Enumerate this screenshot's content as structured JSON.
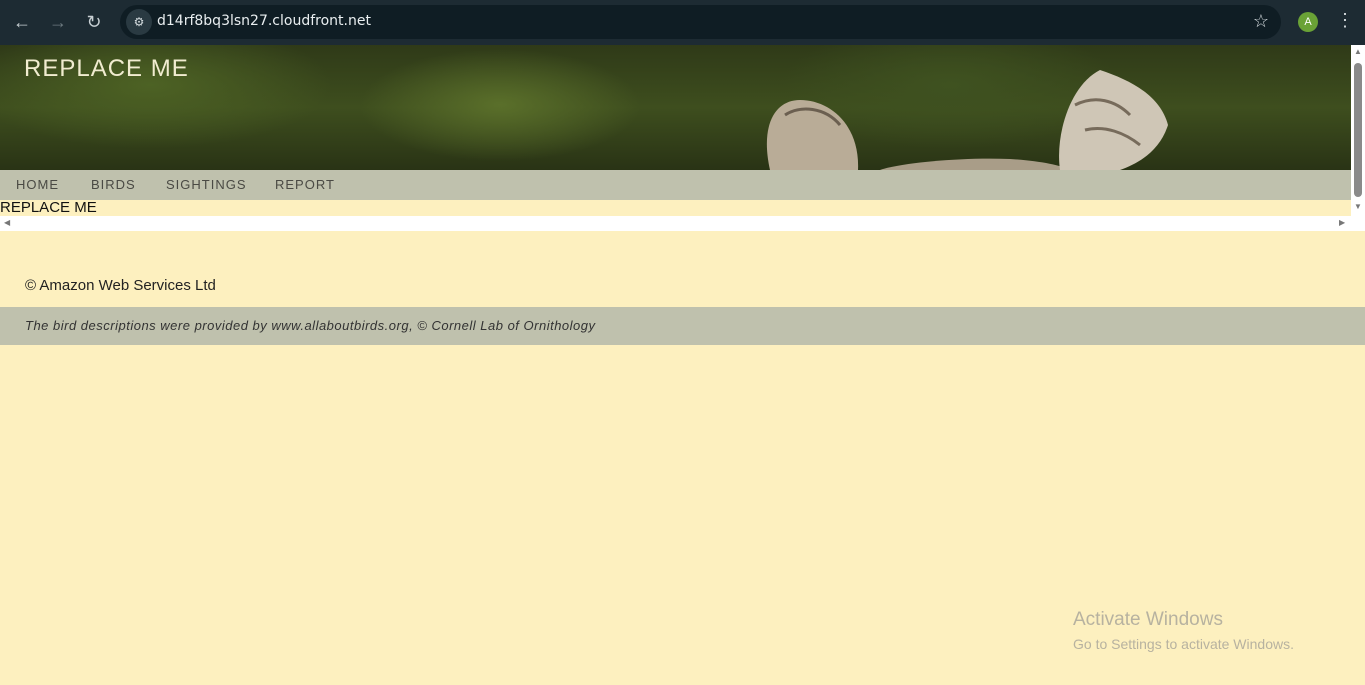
{
  "browser": {
    "url": "d14rf8bq3lsn27.cloudfront.net",
    "back_icon": "arrow-left",
    "forward_icon": "arrow-right",
    "reload_icon": "reload",
    "site_info_icon": "tune",
    "bookmark_icon": "star",
    "profile_initial": "A",
    "menu_icon": "more-vert"
  },
  "header": {
    "title": "REPLACE ME"
  },
  "nav": {
    "items": [
      "HOME",
      "BIRDS",
      "SIGHTINGS",
      "REPORT"
    ]
  },
  "content": {
    "placeholder": "REPLACE ME"
  },
  "footer": {
    "copyright": "© Amazon Web Services Ltd",
    "credit": "The bird descriptions were provided by www.allaboutbirds.org, © Cornell Lab of Ornithology"
  },
  "os_watermark": {
    "title": "Activate Windows",
    "subtitle": "Go to Settings to activate Windows."
  },
  "colors": {
    "page_bg": "#fdf0bf",
    "nav_bg": "#bfc1ad",
    "chrome_bg": "#1d2b33"
  }
}
